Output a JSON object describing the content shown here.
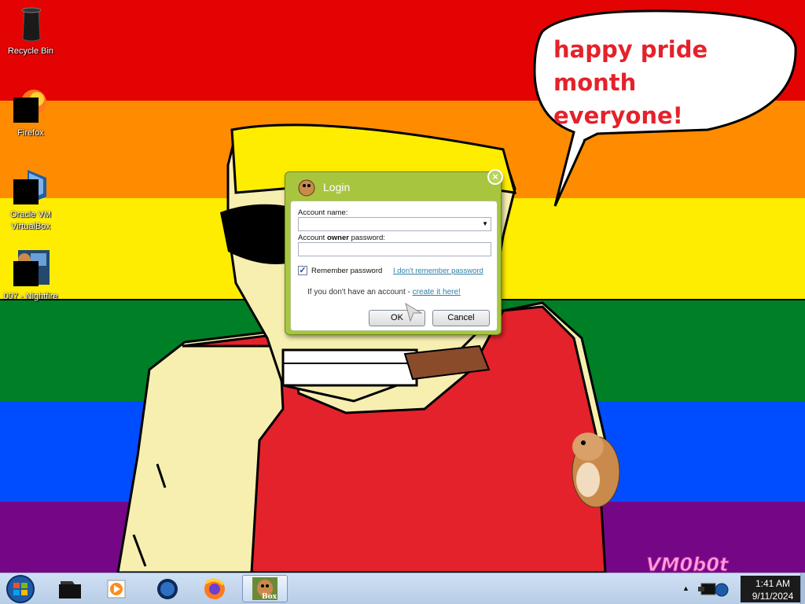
{
  "desktop": {
    "flag_colors": [
      "#e40303",
      "#ff8c00",
      "#ffed00",
      "#008026",
      "#004dff",
      "#750787"
    ],
    "icons": [
      {
        "label": "Recycle Bin",
        "icon": "recycle-bin-icon"
      },
      {
        "label": "Firefox",
        "icon": "firefox-icon"
      },
      {
        "label": "Oracle VM VirtualBox",
        "icon": "virtualbox-icon"
      },
      {
        "label": "007 - Nightfire",
        "icon": "game-icon"
      }
    ],
    "speech_bubble": "happy pride month everyone!",
    "watermark": "VM0b0t"
  },
  "login_dialog": {
    "title": "Login",
    "account_name_label": "Account name:",
    "account_name_value": "",
    "password_label_pre": "Account ",
    "password_label_bold": "owner",
    "password_label_post": " password:",
    "password_value": "",
    "remember_label": "Remember password",
    "remember_checked": true,
    "forgot_link": "I don't remember password",
    "no_account_text": "If you don't have an account - ",
    "create_link": "create it here!",
    "ok_label": "OK",
    "cancel_label": "Cancel"
  },
  "taskbar": {
    "pinned": [
      "file-explorer-icon",
      "media-player-icon",
      "virtualbox-icon",
      "firefox-icon",
      "box-app-icon"
    ],
    "active_app_label": "Box",
    "clock_time": "1:41 AM",
    "clock_date": "9/11/2024"
  }
}
